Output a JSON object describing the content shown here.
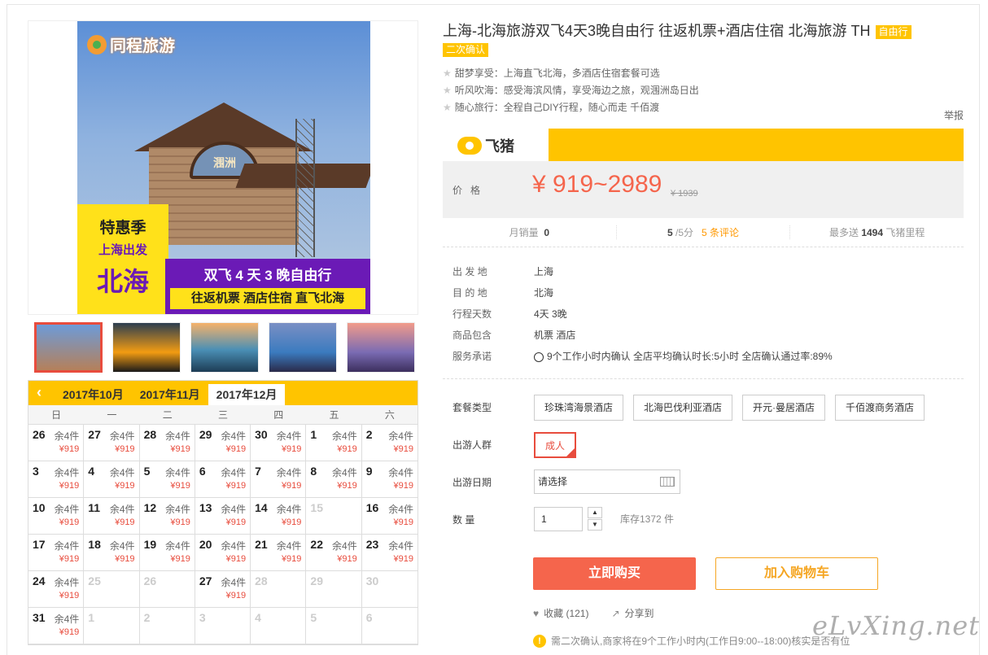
{
  "image": {
    "brand": "同程旅游",
    "sign": "涠洲",
    "promo_1": "特惠季",
    "promo_2": "上海出发",
    "promo_3": "北海",
    "band_1": "双飞 4 天 3 晚自由行",
    "band_2": "往返机票 酒店住宿 直飞北海"
  },
  "calendar": {
    "prev": "‹",
    "tabs": [
      "2017年10月",
      "2017年11月",
      "2017年12月"
    ],
    "weekdays": [
      "日",
      "一",
      "二",
      "三",
      "四",
      "五",
      "六"
    ],
    "stock_label": "余4件",
    "price_label": "¥919",
    "days": [
      {
        "d": "26",
        "a": true
      },
      {
        "d": "27",
        "a": true
      },
      {
        "d": "28",
        "a": true
      },
      {
        "d": "29",
        "a": true
      },
      {
        "d": "30",
        "a": true
      },
      {
        "d": "1",
        "a": true
      },
      {
        "d": "2",
        "a": true
      },
      {
        "d": "3",
        "a": true
      },
      {
        "d": "4",
        "a": true
      },
      {
        "d": "5",
        "a": true
      },
      {
        "d": "6",
        "a": true
      },
      {
        "d": "7",
        "a": true
      },
      {
        "d": "8",
        "a": true
      },
      {
        "d": "9",
        "a": true
      },
      {
        "d": "10",
        "a": true
      },
      {
        "d": "11",
        "a": true
      },
      {
        "d": "12",
        "a": true
      },
      {
        "d": "13",
        "a": true
      },
      {
        "d": "14",
        "a": true
      },
      {
        "d": "15",
        "a": false
      },
      {
        "d": "16",
        "a": true
      },
      {
        "d": "17",
        "a": true
      },
      {
        "d": "18",
        "a": true
      },
      {
        "d": "19",
        "a": true
      },
      {
        "d": "20",
        "a": true
      },
      {
        "d": "21",
        "a": true
      },
      {
        "d": "22",
        "a": true
      },
      {
        "d": "23",
        "a": true
      },
      {
        "d": "24",
        "a": true
      },
      {
        "d": "25",
        "a": false
      },
      {
        "d": "26",
        "a": false
      },
      {
        "d": "27",
        "a": true
      },
      {
        "d": "28",
        "a": false
      },
      {
        "d": "29",
        "a": false
      },
      {
        "d": "30",
        "a": false
      },
      {
        "d": "31",
        "a": true
      },
      {
        "d": "1",
        "a": false
      },
      {
        "d": "2",
        "a": false
      },
      {
        "d": "3",
        "a": false
      },
      {
        "d": "4",
        "a": false
      },
      {
        "d": "5",
        "a": false
      },
      {
        "d": "6",
        "a": false
      }
    ]
  },
  "product": {
    "title": "上海-北海旅游双飞4天3晚自由行 往返机票+酒店住宿 北海旅游 TH",
    "tag1": "自由行",
    "tag2": "二次确认",
    "features": [
      "甜梦享受：上海直飞北海，多酒店住宿套餐可选",
      "听风吹海：感受海滨风情，享受海边之旅，观涠洲岛日出",
      "随心旅行：全程自己DIY行程，随心而走 千佰渡"
    ],
    "report": "举报",
    "fliggy": "飞猪",
    "price_label": "价格",
    "price": "¥ 919~2989",
    "price_old": "¥ 1939",
    "monthly_sales_label": "月销量",
    "monthly_sales": "0",
    "rating": "5",
    "rating_suffix": "/5分",
    "reviews": "5 条评论",
    "miles_prefix": "最多送",
    "miles": "1494",
    "miles_suffix": "飞猪里程"
  },
  "details": [
    {
      "k": "出 发 地",
      "v": "上海"
    },
    {
      "k": "目 的 地",
      "v": "北海"
    },
    {
      "k": "行程天数",
      "v": "4天 3晚"
    },
    {
      "k": "商品包含",
      "v": "机票  酒店"
    },
    {
      "k": "服务承诺",
      "v": "9个工作小时内确认    全店平均确认时长:5小时    全店确认通过率:89%"
    }
  ],
  "options": {
    "package_label": "套餐类型",
    "packages": [
      "珍珠湾海景酒店",
      "北海巴伐利亚酒店",
      "开元·曼居酒店",
      "千佰渡商务酒店"
    ],
    "crowd_label": "出游人群",
    "crowd": "成人",
    "date_label": "出游日期",
    "date_value": "请选择",
    "qty_label": "数    量",
    "qty_value": "1",
    "qty_up": "▲",
    "qty_down": "▼",
    "stock": "库存1372 件"
  },
  "buttons": {
    "buy": "立即购买",
    "cart": "加入购物车",
    "fav": "收藏 (121)",
    "share": "分享到"
  },
  "notice": "需二次确认,商家将在9个工作小时内(工作日9:00--18:00)核实是否有位",
  "watermark": "eLvXing.net"
}
